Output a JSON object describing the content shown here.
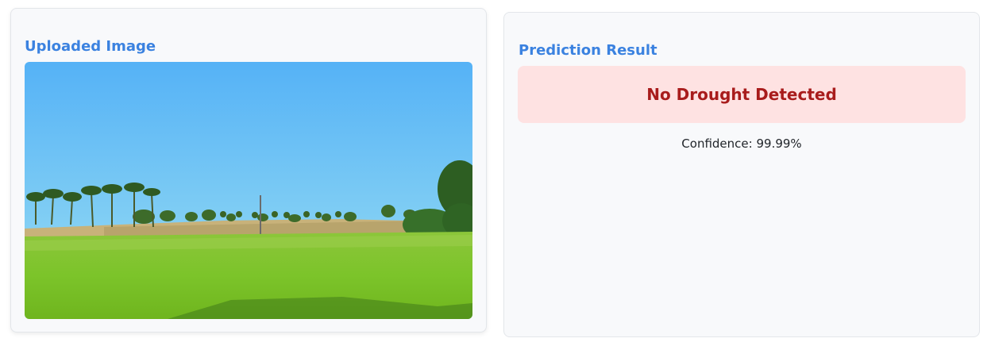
{
  "upload_panel": {
    "title": "Uploaded Image",
    "image_subject": "green paddy field under blue sky with palm trees"
  },
  "result_panel": {
    "title": "Prediction Result",
    "prediction": "No Drought Detected",
    "confidence_label": "Confidence:",
    "confidence_value": "99.99%"
  },
  "colors": {
    "accent": "#3b82e0",
    "result_bg": "#fee2e2",
    "result_text": "#a81c1c",
    "card_bg": "#f8f9fb"
  }
}
